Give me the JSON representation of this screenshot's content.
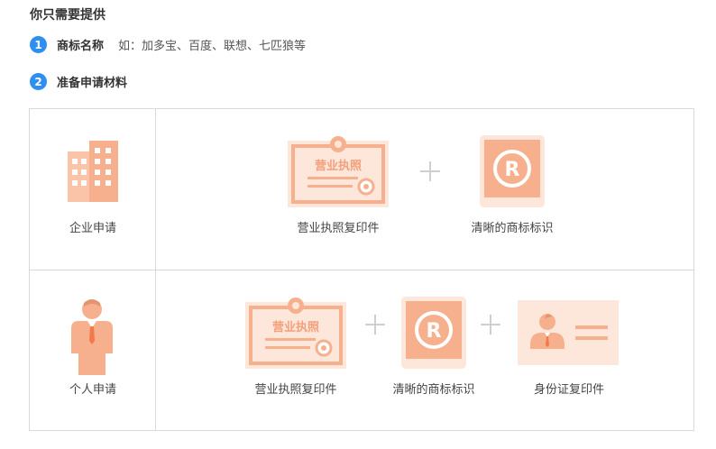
{
  "heading": "你只需要提供",
  "steps": [
    {
      "num": "1",
      "label": "商标名称",
      "desc": "如：加多宝、百度、联想、七匹狼等"
    },
    {
      "num": "2",
      "label": "准备申请材料",
      "desc": ""
    }
  ],
  "rows": [
    {
      "label": "企业申请",
      "icon": "building-icon",
      "materials": [
        {
          "caption": "营业执照复印件",
          "icon": "business-license-icon",
          "license_text": "营业执照"
        },
        {
          "caption": "清晰的商标标识",
          "icon": "trademark-r-icon"
        }
      ]
    },
    {
      "label": "个人申请",
      "icon": "person-icon",
      "materials": [
        {
          "caption": "营业执照复印件",
          "icon": "business-license-icon",
          "license_text": "营业执照"
        },
        {
          "caption": "清晰的商标标识",
          "icon": "trademark-r-icon"
        },
        {
          "caption": "身份证复印件",
          "icon": "id-card-icon"
        }
      ]
    }
  ],
  "colors": {
    "accent_blue": "#2f8ff0",
    "icon_orange": "#f7b08e",
    "icon_light": "#fde6da",
    "border": "#d9d9d9"
  }
}
